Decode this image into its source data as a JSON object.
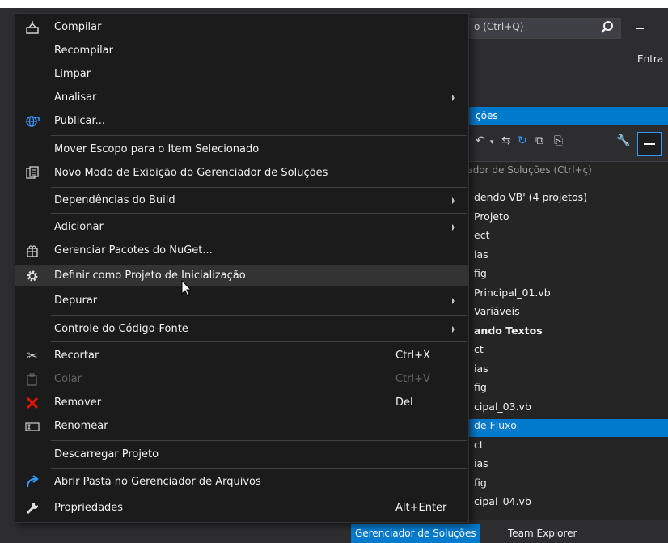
{
  "background": {
    "quick_launch_text": "o (Ctrl+Q)",
    "header_partial_text": "Entra",
    "solution_explorer": {
      "title": "ções",
      "search_placeholder": "iador de Soluções (Ctrl+ç)",
      "tree": [
        {
          "text": "dendo VB' (4 projetos)",
          "bold": false
        },
        {
          "text": "Projeto",
          "bold": false
        },
        {
          "text": "ect",
          "bold": false
        },
        {
          "text": "ias",
          "bold": false
        },
        {
          "text": "fig",
          "bold": false
        },
        {
          "text": "Principal_01.vb",
          "bold": false
        },
        {
          "text": "Variáveis",
          "bold": false
        },
        {
          "text": "ando Textos",
          "bold": true
        },
        {
          "text": "ct",
          "bold": false
        },
        {
          "text": "ias",
          "bold": false
        },
        {
          "text": "fig",
          "bold": false
        },
        {
          "text": "cipal_03.vb",
          "bold": false
        },
        {
          "text": "de Fluxo",
          "bold": false,
          "selected": true
        },
        {
          "text": "ct",
          "bold": false
        },
        {
          "text": "ias",
          "bold": false
        },
        {
          "text": "fig",
          "bold": false
        },
        {
          "text": "cipal_04.vb",
          "bold": false
        }
      ]
    },
    "bottom_tabs": {
      "active": "Gerenciador de Soluções",
      "inactive": "Team Explorer"
    }
  },
  "context_menu": {
    "items": [
      {
        "id": "compilar",
        "label": "Compilar",
        "icon": "build-icon"
      },
      {
        "id": "recompilar",
        "label": "Recompilar"
      },
      {
        "id": "limpar",
        "label": "Limpar"
      },
      {
        "id": "analisar",
        "label": "Analisar",
        "submenu": true
      },
      {
        "id": "publicar",
        "label": "Publicar...",
        "icon": "publish-globe-icon"
      },
      {
        "id": "mover-escopo",
        "label": "Mover Escopo para o Item Selecionado"
      },
      {
        "id": "novo-modo",
        "label": "Novo Modo de Exibição do Gerenciador de Soluções",
        "icon": "new-view-icon"
      },
      {
        "id": "dependencias",
        "label": "Dependências do Build",
        "submenu": true
      },
      {
        "id": "adicionar",
        "label": "Adicionar",
        "submenu": true
      },
      {
        "id": "nuget",
        "label": "Gerenciar Pacotes do NuGet...",
        "icon": "nuget-package-icon"
      },
      {
        "id": "definir-inicializacao",
        "label": "Definir como Projeto de Inicialização",
        "icon": "gear-icon",
        "highlighted": true
      },
      {
        "id": "depurar",
        "label": "Depurar",
        "submenu": true
      },
      {
        "id": "controle-codigo",
        "label": "Controle do Código-Fonte",
        "submenu": true
      },
      {
        "id": "recortar",
        "label": "Recortar",
        "shortcut": "Ctrl+X",
        "icon": "scissors-icon"
      },
      {
        "id": "colar",
        "label": "Colar",
        "shortcut": "Ctrl+V",
        "icon": "paste-icon",
        "disabled": true
      },
      {
        "id": "remover",
        "label": "Remover",
        "shortcut": "Del",
        "icon": "red-x-icon"
      },
      {
        "id": "renomear",
        "label": "Renomear",
        "icon": "rename-icon"
      },
      {
        "id": "descarregar",
        "label": "Descarregar Projeto"
      },
      {
        "id": "abrir-pasta",
        "label": "Abrir Pasta no Gerenciador de Arquivos",
        "icon": "open-folder-arrow-icon"
      },
      {
        "id": "propriedades",
        "label": "Propriedades",
        "shortcut": "Alt+Enter",
        "icon": "wrench-icon"
      }
    ]
  },
  "colors": {
    "accent": "#007acc",
    "remove_icon": "#e51400",
    "menu_background": "#1b1b1c",
    "highlight": "#333334"
  }
}
